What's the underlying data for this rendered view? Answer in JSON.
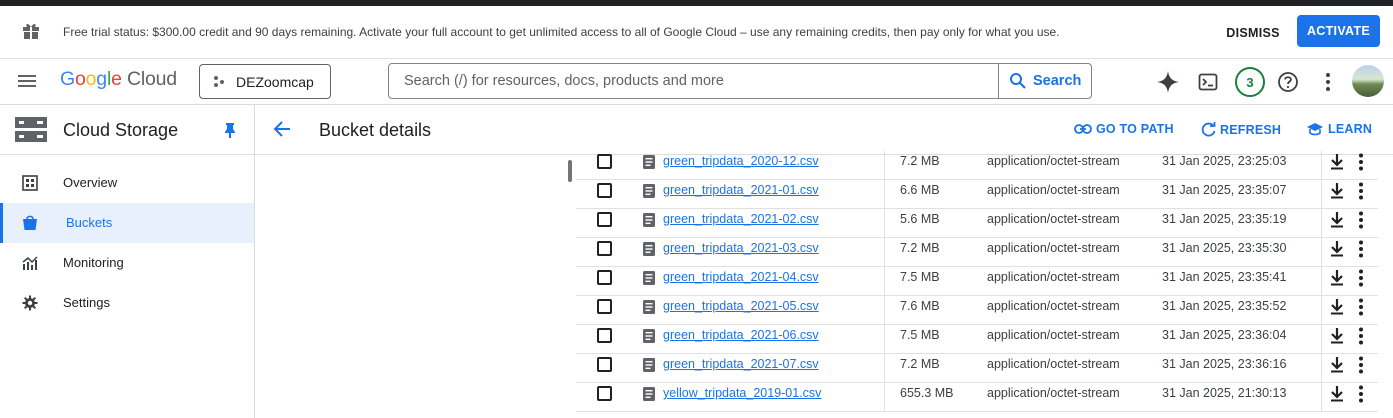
{
  "trial_banner": {
    "message": "Free trial status: $300.00 credit and 90 days remaining. Activate your full account to get unlimited access to all of Google Cloud – use any remaining credits, then pay only for what you use.",
    "dismiss_label": "DISMISS",
    "activate_label": "ACTIVATE"
  },
  "header": {
    "logo": {
      "g1": "G",
      "g2": "o",
      "g3": "o",
      "g4": "g",
      "g5": "l",
      "g6": "e",
      "cloud": " Cloud"
    },
    "project": "DEZoomcap",
    "search_placeholder": "Search (/) for resources, docs, products and more",
    "search_button": "Search",
    "notification_count": "3"
  },
  "sidebar": {
    "title": "Cloud Storage",
    "items": [
      {
        "label": "Overview",
        "icon": "overview-icon"
      },
      {
        "label": "Buckets",
        "icon": "bucket-icon"
      },
      {
        "label": "Monitoring",
        "icon": "monitoring-icon"
      },
      {
        "label": "Settings",
        "icon": "gear-icon"
      }
    ],
    "active_item": "Buckets"
  },
  "main": {
    "title": "Bucket details",
    "actions": {
      "go_to_path": "GO TO PATH",
      "refresh": "REFRESH",
      "learn": "LEARN"
    }
  },
  "files": [
    {
      "name": "green_tripdata_2020-12.csv",
      "size": "7.2 MB",
      "type": "application/octet-stream",
      "created": "31 Jan 2025, 23:25:03"
    },
    {
      "name": "green_tripdata_2021-01.csv",
      "size": "6.6 MB",
      "type": "application/octet-stream",
      "created": "31 Jan 2025, 23:35:07"
    },
    {
      "name": "green_tripdata_2021-02.csv",
      "size": "5.6 MB",
      "type": "application/octet-stream",
      "created": "31 Jan 2025, 23:35:19"
    },
    {
      "name": "green_tripdata_2021-03.csv",
      "size": "7.2 MB",
      "type": "application/octet-stream",
      "created": "31 Jan 2025, 23:35:30"
    },
    {
      "name": "green_tripdata_2021-04.csv",
      "size": "7.5 MB",
      "type": "application/octet-stream",
      "created": "31 Jan 2025, 23:35:41"
    },
    {
      "name": "green_tripdata_2021-05.csv",
      "size": "7.6 MB",
      "type": "application/octet-stream",
      "created": "31 Jan 2025, 23:35:52"
    },
    {
      "name": "green_tripdata_2021-06.csv",
      "size": "7.5 MB",
      "type": "application/octet-stream",
      "created": "31 Jan 2025, 23:36:04"
    },
    {
      "name": "green_tripdata_2021-07.csv",
      "size": "7.2 MB",
      "type": "application/octet-stream",
      "created": "31 Jan 2025, 23:36:16"
    },
    {
      "name": "yellow_tripdata_2019-01.csv",
      "size": "655.3 MB",
      "type": "application/octet-stream",
      "created": "31 Jan 2025, 21:30:13"
    }
  ],
  "colors": {
    "accent": "#1a73e8",
    "notification": "#188038",
    "active_nav_bg": "#e8f0fe"
  }
}
